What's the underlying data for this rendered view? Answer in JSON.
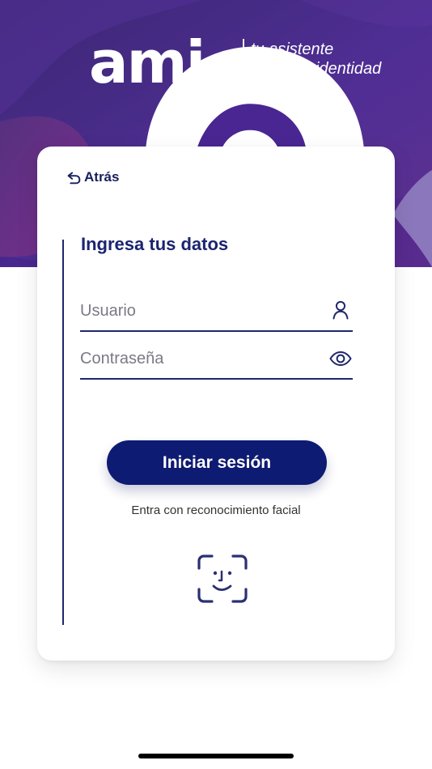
{
  "brand": {
    "name": "ami",
    "tagline_line1": "tu asistente",
    "tagline_line2": "móvil de identidad"
  },
  "form": {
    "back_label": "Atrás",
    "title": "Ingresa tus datos",
    "username_placeholder": "Usuario",
    "password_placeholder": "Contraseña",
    "login_button": "Iniciar sesión",
    "face_login_text": "Entra con reconocimiento facial"
  },
  "icons": {
    "back": "back-arrow-icon",
    "user": "user-icon",
    "password_visibility": "eye-icon",
    "face_id": "face-id-icon",
    "brand_mark": "brand-mark-icon"
  },
  "colors": {
    "primary": "#0e1b72",
    "text_dark": "#1b2470",
    "hero_start": "#3a1f7a",
    "hero_end": "#6a2b8b",
    "card": "#ffffff"
  }
}
